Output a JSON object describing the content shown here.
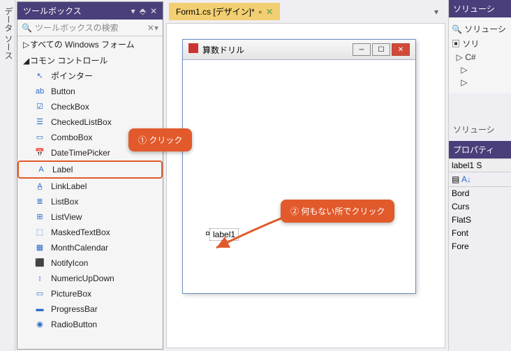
{
  "side_tab": "データ ソース",
  "toolbox": {
    "title": "ツールボックス",
    "search_placeholder": "ツールボックスの検索",
    "categories": [
      "すべての Windows フォーム",
      "コモン コントロール"
    ],
    "items": [
      {
        "icon": "pointer",
        "label": "ポインター"
      },
      {
        "icon": "button",
        "label": "Button"
      },
      {
        "icon": "checkbox",
        "label": "CheckBox"
      },
      {
        "icon": "checkedlistbox",
        "label": "CheckedListBox"
      },
      {
        "icon": "combobox",
        "label": "ComboBox"
      },
      {
        "icon": "datetimepicker",
        "label": "DateTimePicker"
      },
      {
        "icon": "label",
        "label": "Label",
        "highlight": true
      },
      {
        "icon": "linklabel",
        "label": "LinkLabel"
      },
      {
        "icon": "listbox",
        "label": "ListBox"
      },
      {
        "icon": "listview",
        "label": "ListView"
      },
      {
        "icon": "maskedtextbox",
        "label": "MaskedTextBox"
      },
      {
        "icon": "monthcalendar",
        "label": "MonthCalendar"
      },
      {
        "icon": "notifyicon",
        "label": "NotifyIcon"
      },
      {
        "icon": "numericupdown",
        "label": "NumericUpDown"
      },
      {
        "icon": "picturebox",
        "label": "PictureBox"
      },
      {
        "icon": "progressbar",
        "label": "ProgressBar"
      },
      {
        "icon": "radiobutton",
        "label": "RadioButton"
      }
    ]
  },
  "designer": {
    "tab": "Form1.cs [デザイン]*",
    "form_title": "算数ドリル",
    "label_text": "label1"
  },
  "right": {
    "sol_title": "ソリューシ",
    "sol_search": "ソリューシ",
    "sol_node": "ソリ",
    "sol_footer": "ソリューシ",
    "prop_title": "プロパティ",
    "prop_obj": "label1  S",
    "props": [
      "Bord",
      "Curs",
      "FlatS",
      "Font",
      "Fore"
    ]
  },
  "annotations": [
    "① クリック",
    "② 何もない所でクリック"
  ],
  "icon_glyphs": {
    "pointer": "↖",
    "button": "ab",
    "checkbox": "☑",
    "checkedlistbox": "☰",
    "combobox": "▭",
    "datetimepicker": "📅",
    "label": "A",
    "linklabel": "A̲",
    "listbox": "≣",
    "listview": "⊞",
    "maskedtextbox": "⬚",
    "monthcalendar": "▦",
    "notifyicon": "⬛",
    "numericupdown": "↕",
    "picturebox": "▭",
    "progressbar": "▬",
    "radiobutton": "◉"
  }
}
